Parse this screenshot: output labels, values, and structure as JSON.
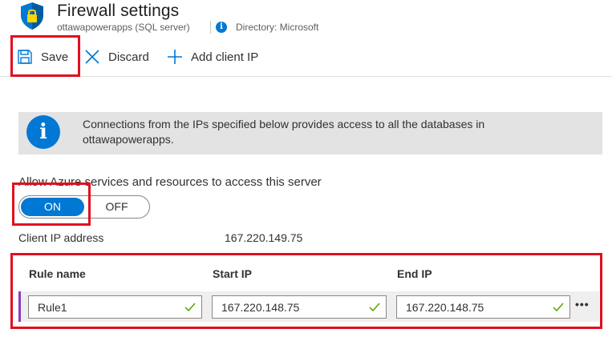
{
  "header": {
    "title": "Firewall settings",
    "subtitle": "ottawapowerapps (SQL server)",
    "directory": "Directory: Microsoft"
  },
  "toolbar": {
    "save_label": "Save",
    "discard_label": "Discard",
    "add_client_ip_label": "Add client IP"
  },
  "banner": {
    "text": "Connections from the IPs specified below provides access to all the databases in ottawapowerapps."
  },
  "azure_access": {
    "label": "Allow Azure services and resources to access this server",
    "on_label": "ON",
    "off_label": "OFF",
    "selected": "ON"
  },
  "client_ip": {
    "label": "Client IP address",
    "value": "167.220.149.75"
  },
  "rules_table": {
    "columns": [
      "Rule name",
      "Start IP",
      "End IP"
    ],
    "rows": [
      {
        "rule_name": "Rule1",
        "start_ip": "167.220.148.75",
        "end_ip": "167.220.148.75"
      }
    ],
    "more_icon": "ellipsis-icon"
  },
  "colors": {
    "accent": "#0078d4",
    "highlight": "#e0101e",
    "valid_check": "#57a300",
    "row_accent": "#8e3cbf"
  }
}
